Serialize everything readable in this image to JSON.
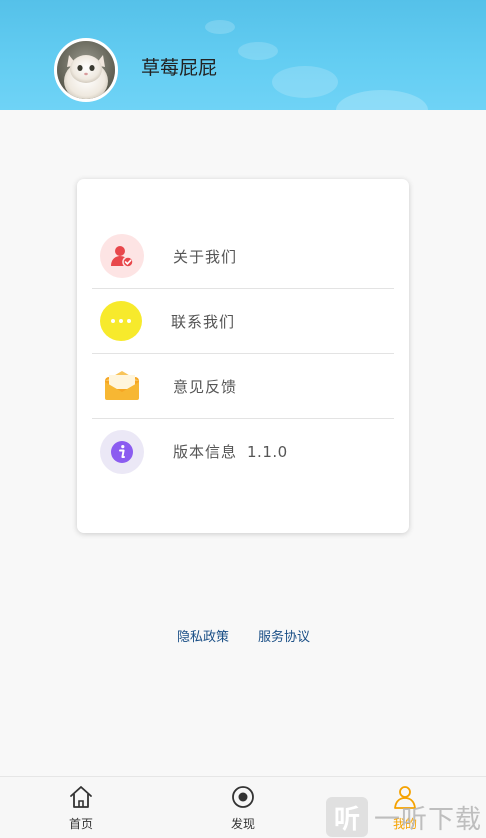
{
  "profile": {
    "username": "草莓屁屁"
  },
  "menu": {
    "items": [
      {
        "label": "关于我们",
        "icon": "user-check-icon",
        "color": "#e8474b",
        "bg": "#fde4e4"
      },
      {
        "label": "联系我们",
        "icon": "chat-bubble-icon",
        "color": "#f2e21a",
        "bg": "#f7ea2c"
      },
      {
        "label": "意见反馈",
        "icon": "envelope-icon",
        "color": "#f6a623",
        "bg": "#ffffff"
      },
      {
        "label": "版本信息",
        "version": "1.1.0",
        "icon": "info-icon",
        "color": "#8b5cf0",
        "bg": "#ebe8f6"
      }
    ]
  },
  "links": {
    "privacy": "隐私政策",
    "service": "服务协议"
  },
  "bottom_nav": {
    "items": [
      {
        "label": "首页",
        "icon": "home-icon"
      },
      {
        "label": "发现",
        "icon": "discover-icon"
      },
      {
        "label": "我的",
        "icon": "profile-icon",
        "active": true,
        "active_color": "#f5a200"
      }
    ]
  },
  "watermark": {
    "box": "听",
    "text": "一听下载"
  }
}
